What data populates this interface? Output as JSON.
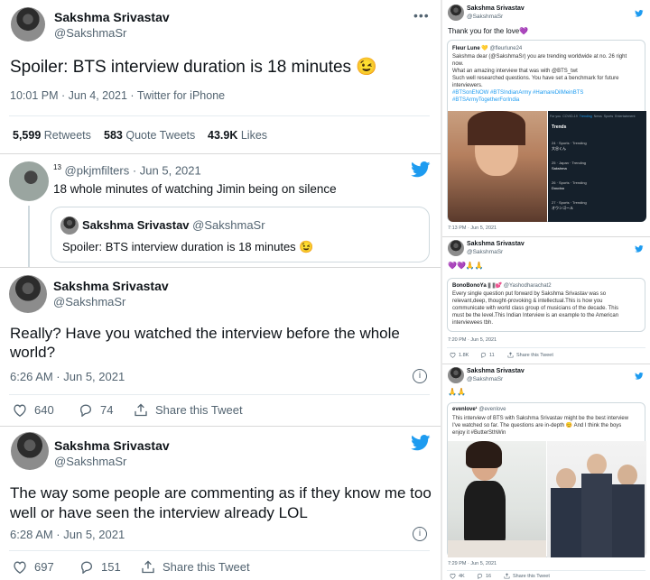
{
  "left": {
    "tweet1": {
      "name": "Sakshma Srivastav",
      "handle": "@SakshmaSr",
      "text": "Spoiler: BTS interview duration is 18 minutes 😉",
      "meta": "10:01 PM · Jun 4, 2021 · Twitter for iPhone",
      "retweets_num": "5,599",
      "retweets_label": "Retweets",
      "quotes_num": "583",
      "quotes_label": "Quote Tweets",
      "likes_num": "43.9K",
      "likes_label": "Likes"
    },
    "reply": {
      "badge": "13",
      "handle_time": "@pkjmfilters · Jun 5, 2021",
      "text": "18 whole minutes of watching Jimin  being on silence",
      "quote_name": "Sakshma Srivastav",
      "quote_handle": "@SakshmaSr",
      "quote_text": "Spoiler: BTS interview duration is 18 minutes 😉"
    },
    "tweet2": {
      "name": "Sakshma Srivastav",
      "handle": "@SakshmaSr",
      "text": "Really? Have you watched the interview before the whole world?",
      "meta": "6:26 AM · Jun 5, 2021",
      "likes": "640",
      "replies": "74",
      "share": "Share this Tweet"
    },
    "tweet3": {
      "name": "Sakshma Srivastav",
      "handle": "@SakshmaSr",
      "text": "The way some people are commenting as if they know me too well or have seen the interview already LOL",
      "meta": "6:28 AM · Jun 5, 2021",
      "likes": "697",
      "replies": "151",
      "share": "Share this Tweet"
    }
  },
  "right": {
    "card1": {
      "name": "Sakshma Srivastav",
      "handle": "@SakshmaSr",
      "text": "Thank you for the love💜",
      "quote_name": "Fleur Lune 💛",
      "quote_handle": "@fleurlune24",
      "quote_lines": [
        "Sakshma dear (@SakshmaSr) you are trending worldwide at no. 26 right",
        "now.",
        "What an amazing interview that was with @BTS_twt",
        "Such well researched questions. You have set a benchmark for future",
        "interviewers.",
        "#BTSonENOW #BTSIndianArmy #HamareDilMeinBTS",
        "#BTSArmyTogetherForIndia"
      ],
      "trends_tabs": [
        "For you",
        "COVID-19",
        "Trending",
        "News",
        "Sports",
        "Entertainment"
      ],
      "trends_title": "Trends",
      "trends_items": [
        "24 · Sports · Trending",
        "大谷くん",
        "25 · Japan · Trending",
        "Sakshma",
        "26 · Sports · Trending",
        "Doudou",
        "27 · Sports · Trending",
        "オウンゴール"
      ],
      "meta": "7:13 PM · Jun 5, 2021"
    },
    "card2": {
      "name": "Sakshma Srivastav",
      "handle": "@SakshmaSr",
      "text": "💜💜🙏🙏",
      "quote_name": "BonoBonoYa || ||💕",
      "quote_handle": "@Yashodharachat2",
      "quote_lines": [
        "Every single question put forward by Sakshma Srivastav was so",
        "relevant,deep, thought-provoking & intellectual.This is how you",
        "communicate with world class group of musicians of the decade. This",
        "must be the level.This Indian Interview is an example to the American",
        "interviewees tbh."
      ],
      "meta": "7:20 PM · Jun 5, 2021",
      "likes": "1.8K",
      "replies": "11",
      "share": "Share this Tweet"
    },
    "card3": {
      "name": "Sakshma Srivastav",
      "handle": "@SakshmaSr",
      "text": "🙏🙏",
      "quote_name": "evenlove¹",
      "quote_handle": "@evenlove",
      "quote_lines": [
        "This interview of BTS with Sakshma Srivastav might be the best interview",
        "I've watched so far. The questions are in-depth 😊 And I think the boys",
        "enjoy it #ButterSthWin"
      ],
      "meta": "7:29 PM · Jun 5, 2021",
      "likes": "4K",
      "replies": "16",
      "share": "Share this Tweet"
    }
  },
  "colors": {
    "accent": "#1d9bf0",
    "text": "#0f1419",
    "muted": "#536471",
    "border": "#cfd9de"
  },
  "icons": [
    "twitter-bird-icon",
    "more-icon",
    "info-icon",
    "heart-icon",
    "reply-icon",
    "share-icon"
  ]
}
